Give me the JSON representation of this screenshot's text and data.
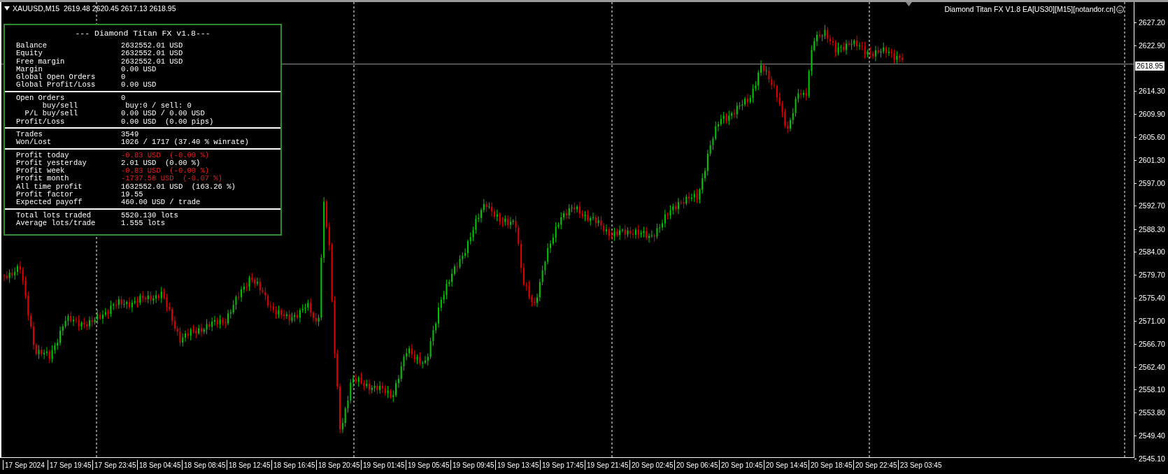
{
  "chart": {
    "header": "XAUUSD,M15  2619.48 2620.45 2617.13 2618.95",
    "ea_label": "Diamond Titan FX V1.8 EA[US30][M15][notandor.cn]",
    "current_price": "2618.95",
    "price_ticks": [
      "2627.20",
      "2622.90",
      "2614.30",
      "2609.90",
      "2605.60",
      "2601.30",
      "2597.00",
      "2592.70",
      "2588.30",
      "2584.00",
      "2579.70",
      "2575.40",
      "2571.00",
      "2566.70",
      "2562.40",
      "2558.10",
      "2553.80",
      "2549.40",
      "2545.10"
    ],
    "time_ticks": [
      "17 Sep 2024",
      "17 Sep 19:45",
      "17 Sep 23:45",
      "18 Sep 04:45",
      "18 Sep 08:45",
      "18 Sep 12:45",
      "18 Sep 16:45",
      "18 Sep 20:45",
      "19 Sep 01:45",
      "19 Sep 05:45",
      "19 Sep 09:45",
      "19 Sep 13:45",
      "19 Sep 17:45",
      "19 Sep 21:45",
      "20 Sep 02:45",
      "20 Sep 06:45",
      "20 Sep 10:45",
      "20 Sep 14:45",
      "20 Sep 18:45",
      "20 Sep 22:45",
      "23 Sep 03:45"
    ]
  },
  "panel": {
    "title": "--- Diamond Titan FX v1.8---",
    "sections": [
      {
        "rows": [
          {
            "label": "Balance",
            "value": "2632552.01 USD",
            "negative": false
          },
          {
            "label": "Equity",
            "value": "2632552.01 USD",
            "negative": false
          },
          {
            "label": "Free margin",
            "value": "2632552.01 USD",
            "negative": false
          },
          {
            "label": "Margin",
            "value": "0.00 USD",
            "negative": false
          },
          {
            "label": "Global Open Orders",
            "value": "0",
            "negative": false
          },
          {
            "label": "Global Profit/Loss",
            "value": "0.00 USD",
            "negative": false
          }
        ]
      },
      {
        "rows": [
          {
            "label": "Open Orders",
            "value": "0",
            "negative": false
          },
          {
            "label": "      buy/sell",
            "value": " buy:0 / sell: 0",
            "negative": false
          },
          {
            "label": "  P/L buy/sell",
            "value": "0.00 USD / 0.00 USD",
            "negative": false
          },
          {
            "label": "Profit/Loss",
            "value": "0.00 USD  (0.00 pips)",
            "negative": false
          }
        ]
      },
      {
        "rows": [
          {
            "label": "Trades",
            "value": "3549",
            "negative": false
          },
          {
            "label": "Won/Lost",
            "value": "1026 / 1717 (37.40 % winrate)",
            "negative": false
          }
        ]
      },
      {
        "rows": [
          {
            "label": "Profit today",
            "value": "-0.83 USD  (-0.00 %)",
            "negative": true
          },
          {
            "label": "Profit yesterday",
            "value": "2.01 USD  (0.00 %)",
            "negative": false
          },
          {
            "label": "Profit week",
            "value": "-0.83 USD  (-0.00 %)",
            "negative": true
          },
          {
            "label": "Profit month",
            "value": "-1737.58 USD  (-0.07 %)",
            "negative": true
          },
          {
            "label": "All time profit",
            "value": "1632552.01 USD  (163.26 %)",
            "negative": false
          },
          {
            "label": "Profit factor",
            "value": "19.55",
            "negative": false
          },
          {
            "label": "Expected payoff",
            "value": "460.00 USD / trade",
            "negative": false
          }
        ]
      },
      {
        "rows": [
          {
            "label": "Total lots traded",
            "value": "5520.130 lots",
            "negative": false
          },
          {
            "label": "Average lots/trade",
            "value": "1.555 lots",
            "negative": false
          }
        ]
      }
    ]
  }
}
